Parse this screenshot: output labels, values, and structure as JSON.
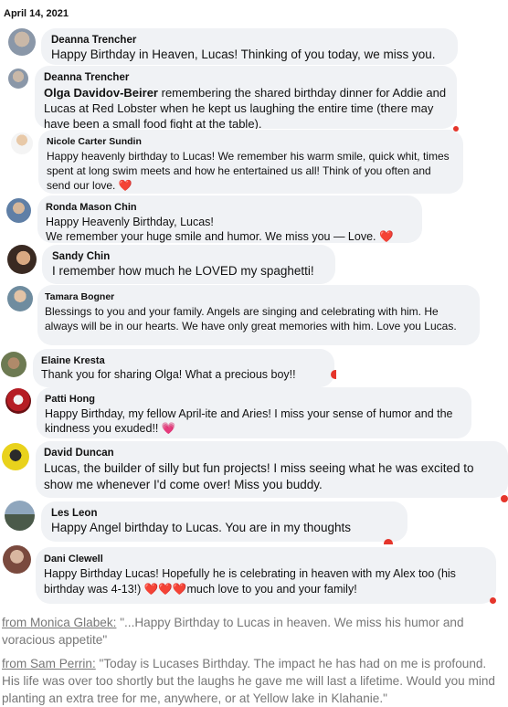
{
  "date": "April 14, 2021",
  "comments": [
    {
      "name": "Deanna Trencher",
      "text": "Happy Birthday in Heaven, Lucas! Thinking of you today, we miss you."
    },
    {
      "name": "Deanna Trencher",
      "tag": "Olga Davidov-Beirer",
      "text": " remembering the shared birthday dinner for Addie and Lucas at Red Lobster when he kept us laughing the entire time (there may have been a small food fight at the table)."
    },
    {
      "name": "Nicole Carter Sundin",
      "text": "Happy heavenly birthday to Lucas! We remember his warm smile, quick whit, times spent at long swim meets and how he entertained us all! Think of you often and send our love. ",
      "heart": "❤️"
    },
    {
      "name": "Ronda Mason Chin",
      "line1": "Happy Heavenly Birthday, Lucas!",
      "text": "We remember your huge smile and humor. We miss you — Love. ",
      "heart": "❤️"
    },
    {
      "name": "Sandy Chin",
      "text": "I remember how much he LOVED my spaghetti!"
    },
    {
      "name": "Tamara Bogner",
      "text": "Blessings to you and your family. Angels are singing and celebrating with him. He always will be in our hearts. We have only great memories with him. Love you Lucas."
    },
    {
      "name": "Elaine Kresta",
      "text": "Thank you for sharing Olga! What a precious boy!! "
    },
    {
      "name": "Patti Hong",
      "text": "Happy Birthday, my fellow April-ite and Aries! I miss your sense of humor and the kindness you exuded!! ",
      "heart": "💗"
    },
    {
      "name": "David Duncan",
      "text": "Lucas, the builder of silly but fun projects! I miss seeing what he was excited to show me whenever I'd come over! Miss you buddy."
    },
    {
      "name": "Les Leon",
      "text": "Happy Angel birthday to Lucas. You are in my thoughts"
    },
    {
      "name": "Dani Clewell",
      "text": "Happy Birthday Lucas! Hopefully he is celebrating in heaven with my Alex too (his birthday was 4-13!) ",
      "hearts": "❤️❤️❤️",
      "text2": "much love to you and your family!"
    }
  ],
  "footer": [
    {
      "source": "from Monica Glabek:",
      "quote": " \"...Happy Birthday to Lucas in heaven. We miss his humor and voracious appetite\""
    },
    {
      "source": "from Sam Perrin:",
      "quote": " \"Today is Lucases Birthday. The impact he has had on me is profound. His life was over too shortly but the laughs he gave me will last a lifetime. Would you mind planting an extra tree for me, anywhere, or at Yellow lake in Klahanie.\""
    }
  ],
  "colors": {
    "bubble": "#f0f2f5",
    "heart": "#e3242b",
    "footer_text": "#777777"
  }
}
